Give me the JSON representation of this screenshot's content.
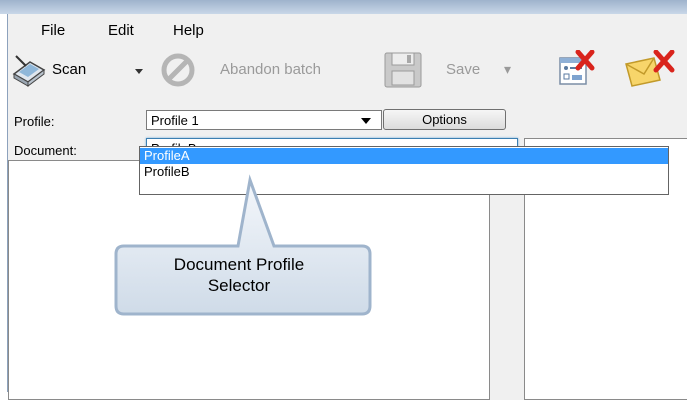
{
  "menu": {
    "file": "File",
    "edit": "Edit",
    "help": "Help"
  },
  "toolbar": {
    "scan_label": "Scan",
    "abandon_label": "Abandon batch",
    "save_label": "Save"
  },
  "form": {
    "profile_label": "Profile:",
    "profile_value": "Profile 1",
    "options_label": "Options",
    "document_label": "Document:",
    "document_value": "ProfileB"
  },
  "dropdown": {
    "options": [
      "ProfileA",
      "ProfileB"
    ],
    "highlighted_index": 0
  },
  "callout": {
    "line1": "Document Profile",
    "line2": "Selector"
  },
  "colors": {
    "selection": "#3399ff",
    "document_combo_border": "#3c7fb1",
    "callout_fill": "#dfe8f1",
    "callout_border": "#9fb4cc"
  }
}
